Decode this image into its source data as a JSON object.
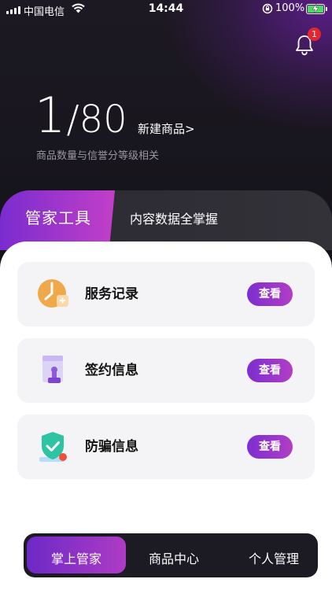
{
  "status_bar": {
    "carrier": "中国电信",
    "time": "14:44",
    "battery": "100%"
  },
  "notifications": {
    "badge_count": "1"
  },
  "summary": {
    "current": "1",
    "separator": "/",
    "total": "80",
    "new_item_link": "新建商品>",
    "note": "商品数量与信誉分等级相关"
  },
  "tabs": [
    {
      "label": "管家工具",
      "active": true
    },
    {
      "label": "内容数据全掌握",
      "active": false
    }
  ],
  "tools": [
    {
      "title": "服务记录",
      "action": "查看",
      "icon": "clock-icon"
    },
    {
      "title": "签约信息",
      "action": "查看",
      "icon": "stamp-icon"
    },
    {
      "title": "防骗信息",
      "action": "查看",
      "icon": "shield-check-icon"
    }
  ],
  "bottom_nav": [
    {
      "label": "掌上管家",
      "active": true
    },
    {
      "label": "商品中心",
      "active": false
    },
    {
      "label": "个人管理",
      "active": false
    }
  ],
  "colors": {
    "accent_start": "#7b2fd0",
    "accent_end": "#b23dc6",
    "header_bg": "#17151c",
    "badge": "#e5262f"
  }
}
